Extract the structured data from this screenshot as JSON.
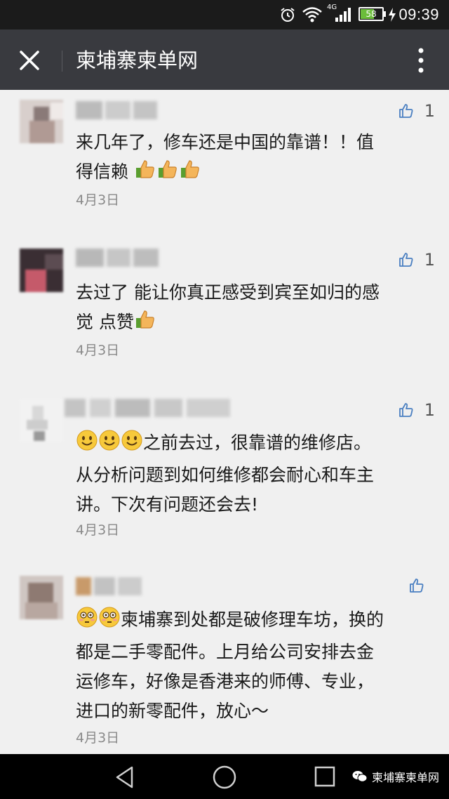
{
  "status_bar": {
    "time": "09:39",
    "battery": "58",
    "network": "4G"
  },
  "header": {
    "title": "柬埔寨柬单网"
  },
  "comments": [
    {
      "likes": "1",
      "text_lines": [
        "来几年了，修车还是中国的靠谱！！值",
        "得信赖"
      ],
      "date": "4月3日",
      "emoji_inline": [
        "thumbs-up",
        "thumbs-up",
        "thumbs-up"
      ]
    },
    {
      "likes": "1",
      "text_lines": [
        "去过了 能让你真正感受到宾至如归的感",
        "觉 点赞"
      ],
      "date": "4月3日",
      "emoji_inline": [
        "thumbs-up"
      ]
    },
    {
      "likes": "1",
      "text_lines": [
        "之前去过，很靠谱的维修店。",
        "从分析问题到如何维修都会耐心和车主",
        "讲。下次有问题还会去!"
      ],
      "date": "4月3日",
      "emoji_inline": [
        "smile",
        "smile",
        "smile"
      ]
    },
    {
      "likes": "",
      "text_lines": [
        "柬埔寨到处都是破修理车坊，换的",
        "都是二手零配件。上月给公司安排去金",
        "运修车，好像是香港来的师傅、专业，",
        "进口的新零配件，放心～"
      ],
      "date": "4月3日",
      "emoji_inline": [
        "flushed",
        "flushed"
      ]
    }
  ],
  "watermark": {
    "text": "柬埔寨柬单网"
  },
  "colors": {
    "header_bg": "#393a3f",
    "status_bg": "#1b1b1b",
    "page_bg": "#f0f0f0",
    "like_icon": "#4a7fc1",
    "date": "#8a8a8a"
  }
}
